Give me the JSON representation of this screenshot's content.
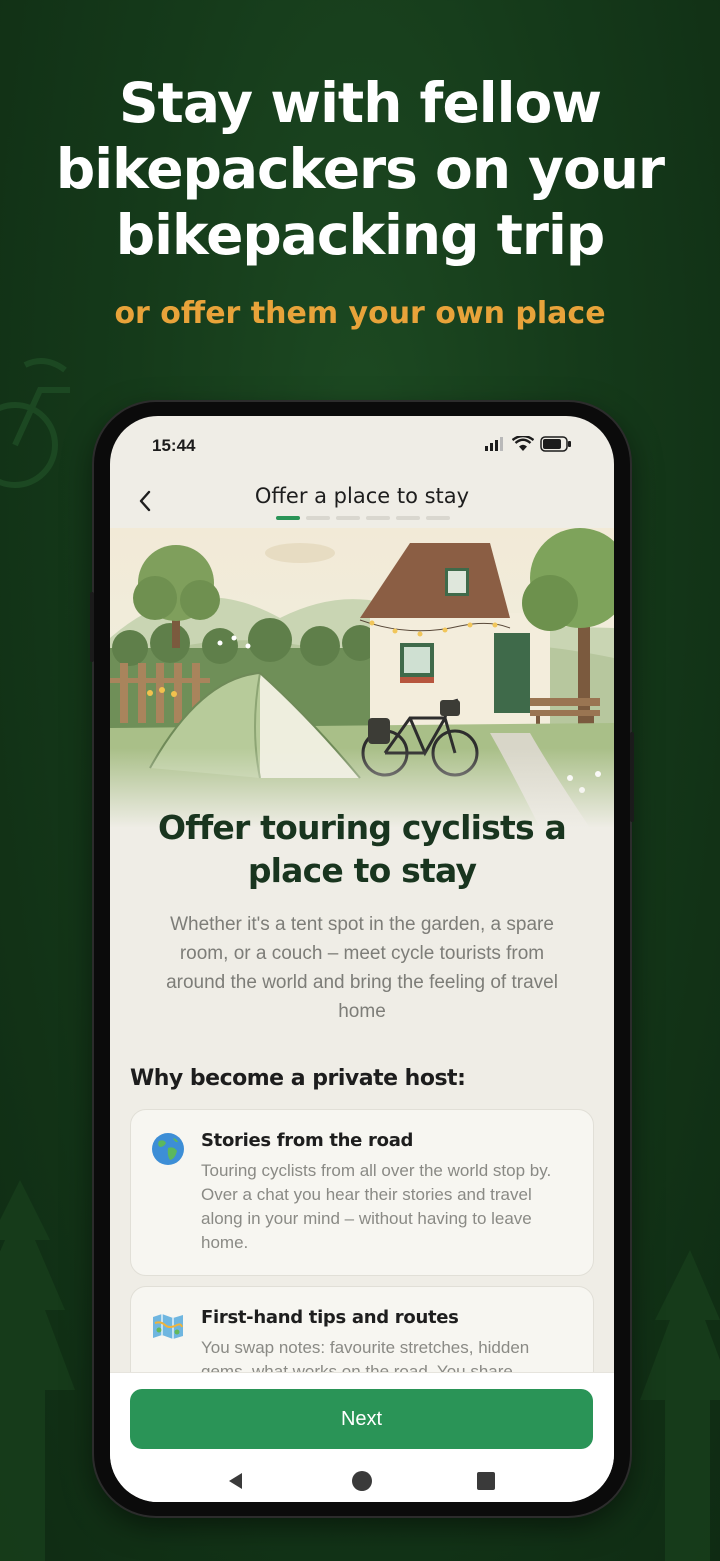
{
  "hero": {
    "title_lines": [
      "Stay with fellow",
      "bikepackers on your",
      "bikepacking trip"
    ],
    "subtitle": "or offer them your own place",
    "subtitle_color": "#e8a33a"
  },
  "status_bar": {
    "time": "15:44",
    "icons": [
      "signal-icon",
      "wifi-icon",
      "battery-icon"
    ]
  },
  "app_bar": {
    "title": "Offer a place to stay",
    "back_icon": "chevron-left-icon",
    "progress": {
      "current_step": 1,
      "total_steps": 6
    }
  },
  "main": {
    "title": "Offer touring cyclists a place to stay",
    "description": "Whether it's a tent spot in the garden, a spare room, or a couch – meet cycle tourists from around the world and bring the feeling of travel home",
    "section_heading": "Why become a private host:",
    "benefits": [
      {
        "icon": "globe-icon",
        "title": "Stories from the road",
        "text": "Touring cyclists from all over the world stop by. Over a chat you hear their stories and travel along in your mind – without having to leave home."
      },
      {
        "icon": "map-icon",
        "title": "First-hand tips and routes",
        "text": "You swap notes: favourite stretches, hidden gems, what works on the road. You share"
      }
    ]
  },
  "footer": {
    "next_label": "Next",
    "accent": "#2a9457"
  },
  "nav_bar": {
    "icons": [
      "back-triangle-icon",
      "home-circle-icon",
      "recents-square-icon"
    ]
  }
}
